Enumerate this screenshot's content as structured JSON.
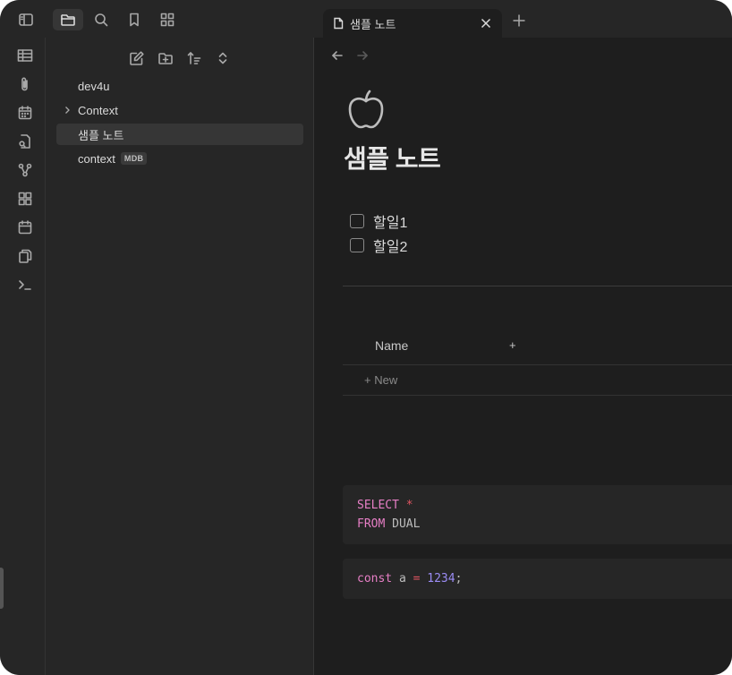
{
  "tab": {
    "title": "샘플 노트"
  },
  "explorer": {
    "items": [
      {
        "label": "dev4u"
      },
      {
        "label": "Context"
      },
      {
        "label": "샘플 노트"
      },
      {
        "label": "context",
        "badge": "MDB"
      }
    ]
  },
  "note": {
    "icon": "apple-icon",
    "title": "샘플 노트",
    "tasks": [
      {
        "label": "할일1",
        "checked": false
      },
      {
        "label": "할일2",
        "checked": false
      }
    ],
    "database": {
      "column": "Name",
      "add_column": "+",
      "new_row": "+ New"
    },
    "code_sql": {
      "line1_kw": "SELECT",
      "line1_op": "*",
      "line2_kw": "FROM",
      "line2_plain": "DUAL"
    },
    "code_js": {
      "kw": "const",
      "var": "a",
      "op": "=",
      "num": "1234",
      "end": ";"
    }
  },
  "colors": {
    "background": "#1e1e1e",
    "sidebar": "#262626",
    "keyword": "#e77fc6",
    "operator": "#e05561",
    "number": "#9b8cf5"
  }
}
